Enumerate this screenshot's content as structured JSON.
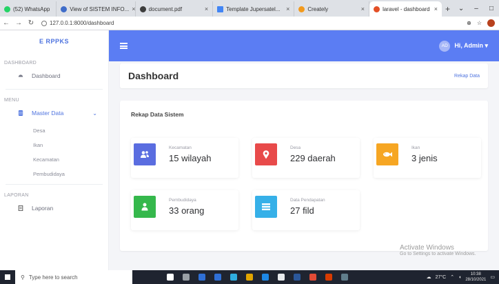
{
  "browser": {
    "tabs": [
      {
        "title": "(52) WhatsApp",
        "color": "#25d366"
      },
      {
        "title": "View of SISTEM INFO...",
        "color": "#3f6cc9"
      },
      {
        "title": "document.pdf",
        "color": "#3d3d3d"
      },
      {
        "title": "Template Jupersatel...",
        "color": "#4285f4"
      },
      {
        "title": "Creately",
        "color": "#f29a1d"
      },
      {
        "title": "laravel - dashboard",
        "color": "#e34f26",
        "active": true
      }
    ],
    "new_tab": "+",
    "url": "127.0.0.1:8000/dashboard",
    "window_controls": [
      "⌄",
      "–",
      "□"
    ]
  },
  "sidebar": {
    "brand": "E RPPKS",
    "sections": [
      {
        "heading": "DASHBOARD",
        "items": [
          {
            "label": "Dashboard",
            "icon": "dashboard-icon"
          }
        ]
      },
      {
        "heading": "MENU",
        "items": [
          {
            "label": "Master Data",
            "icon": "database-icon",
            "active": true,
            "children": [
              "Desa",
              "Ikan",
              "Kecamatan",
              "Pembudidaya"
            ]
          }
        ]
      },
      {
        "heading": "LAPORAN",
        "items": [
          {
            "label": "Laporan",
            "icon": "report-icon"
          }
        ]
      }
    ]
  },
  "topbar": {
    "avatar_text": "AD",
    "user_label": "Hi, Admin ▾"
  },
  "page": {
    "title": "Dashboard",
    "action_link": "Rekap Data"
  },
  "main": {
    "heading": "Rekap Data Sistem",
    "stats": [
      {
        "label": "Kecamatan",
        "value": "15 wilayah",
        "color": "#5a6de0",
        "icon": "users-icon"
      },
      {
        "label": "Desa",
        "value": "229 daerah",
        "color": "#e84a4a",
        "icon": "map-pin-icon"
      },
      {
        "label": "Ikan",
        "value": "3 jenis",
        "color": "#f6a623",
        "icon": "fish-icon"
      },
      {
        "label": "Pembudidaya",
        "value": "33 orang",
        "color": "#35b84c",
        "icon": "user-icon"
      },
      {
        "label": "Data Pendapatan",
        "value": "27 fild",
        "color": "#36b0e8",
        "icon": "list-icon"
      }
    ]
  },
  "watermark": {
    "line1": "Activate Windows",
    "line2": "Go to Settings to activate Windows."
  },
  "taskbar": {
    "search_placeholder": "Type here to search",
    "tray_temp": "27°C",
    "time": "10:38",
    "date": "28/10/2021",
    "app_colors": [
      "#ffffff",
      "#9aa0a6",
      "#2f6fd6",
      "#2f6fd6",
      "#2faee0",
      "#e0a400",
      "#1e88e5",
      "#e8eaed",
      "#2b579a",
      "#e24b36",
      "#d83b01",
      "#607d8b"
    ]
  }
}
